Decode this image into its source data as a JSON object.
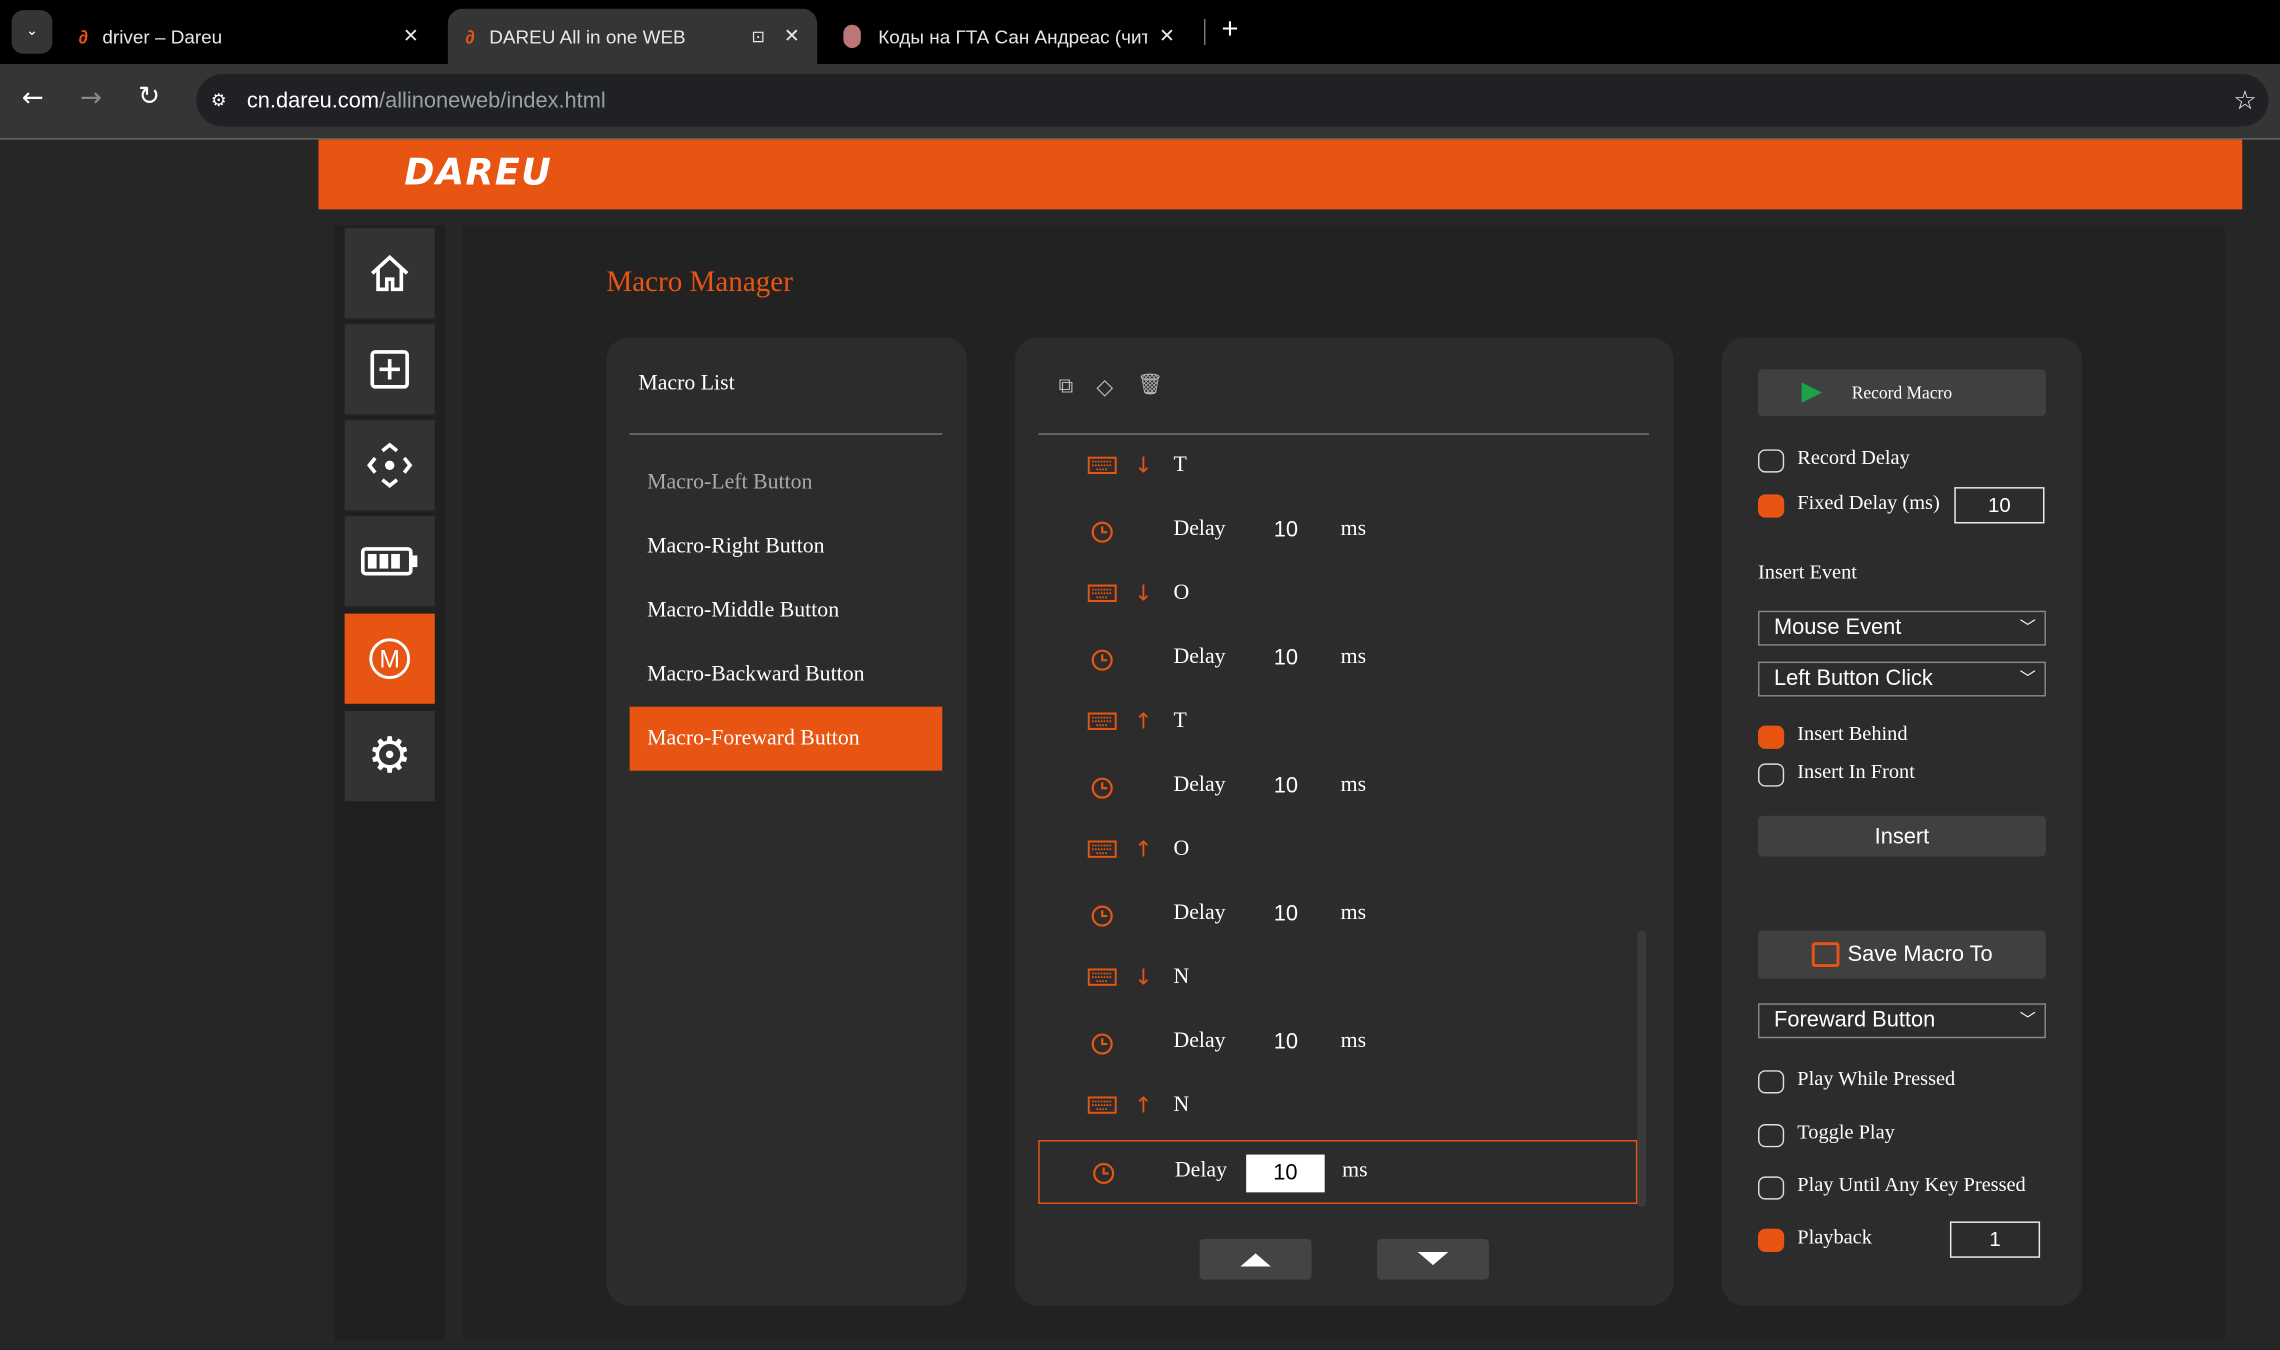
{
  "browser": {
    "tabs": [
      {
        "title": "driver – Dareu"
      },
      {
        "title": "DAREU All in one WEB"
      },
      {
        "title": "Коды на ГТА Сан Андреас (чит"
      }
    ],
    "url_host": "cn.dareu.com",
    "url_path": "/allinoneweb/index.html"
  },
  "brand": {
    "logo": "DAREU",
    "accent": "#e85513"
  },
  "sidebar": {
    "items": [
      {
        "icon": "home-icon"
      },
      {
        "icon": "plus-square-icon"
      },
      {
        "icon": "move-arrows-icon"
      },
      {
        "icon": "battery-icon"
      },
      {
        "icon": "macro-m-icon",
        "active": true
      },
      {
        "icon": "gear-icon"
      }
    ]
  },
  "page_title": "Macro Manager",
  "macro_list": {
    "title": "Macro List",
    "items": [
      "Macro-Left Button",
      "Macro-Right Button",
      "Macro-Middle Button",
      "Macro-Backward Button",
      "Macro-Foreward Button"
    ],
    "selected": 4
  },
  "events": {
    "toolbar": [
      "copy-icon",
      "eraser-icon",
      "trash-icon"
    ],
    "rows": [
      {
        "type": "key",
        "dir": "↓",
        "key": "T"
      },
      {
        "type": "delay",
        "label": "Delay",
        "value": "10",
        "unit": "ms"
      },
      {
        "type": "key",
        "dir": "↓",
        "key": "O"
      },
      {
        "type": "delay",
        "label": "Delay",
        "value": "10",
        "unit": "ms"
      },
      {
        "type": "key",
        "dir": "↑",
        "key": "T"
      },
      {
        "type": "delay",
        "label": "Delay",
        "value": "10",
        "unit": "ms"
      },
      {
        "type": "key",
        "dir": "↑",
        "key": "O"
      },
      {
        "type": "delay",
        "label": "Delay",
        "value": "10",
        "unit": "ms"
      },
      {
        "type": "key",
        "dir": "↓",
        "key": "N"
      },
      {
        "type": "delay",
        "label": "Delay",
        "value": "10",
        "unit": "ms"
      },
      {
        "type": "key",
        "dir": "↑",
        "key": "N"
      },
      {
        "type": "delay",
        "label": "Delay",
        "value": "10",
        "unit": "ms",
        "selected": true
      }
    ]
  },
  "controls": {
    "record": "Record Macro",
    "record_delay": "Record Delay",
    "fixed_delay": "Fixed Delay (ms)",
    "fixed_delay_value": "10",
    "insert_event": "Insert Event",
    "event_type": "Mouse Event",
    "event_action": "Left Button Click",
    "insert_behind": "Insert Behind",
    "insert_front": "Insert In Front",
    "insert": "Insert",
    "save": "Save Macro To",
    "save_target": "Foreward Button",
    "play_while": "Play While Pressed",
    "toggle": "Toggle Play",
    "play_until": "Play Until Any Key Pressed",
    "playback": "Playback",
    "playback_value": "1",
    "checked": {
      "record_delay": false,
      "fixed_delay": true,
      "insert_behind": true,
      "insert_front": false,
      "play_while": false,
      "toggle": false,
      "play_until": false,
      "playback": true
    }
  }
}
